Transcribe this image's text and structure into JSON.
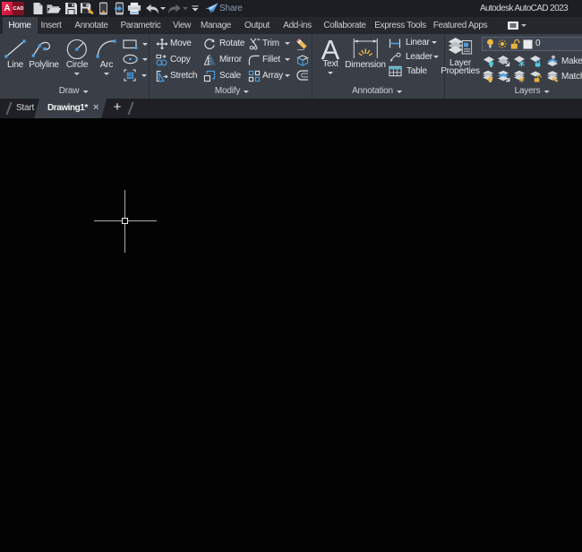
{
  "titlebar": {
    "logo_a": "A",
    "logo_cad": "CAD",
    "share_label": "Share",
    "window_title": "Autodesk AutoCAD 2023"
  },
  "ribbon_tabs": {
    "items": [
      {
        "label": "Home",
        "active": true
      },
      {
        "label": "Insert",
        "active": false
      },
      {
        "label": "Annotate",
        "active": false
      },
      {
        "label": "Parametric",
        "active": false
      },
      {
        "label": "View",
        "active": false
      },
      {
        "label": "Manage",
        "active": false
      },
      {
        "label": "Output",
        "active": false
      },
      {
        "label": "Add-ins",
        "active": false
      },
      {
        "label": "Collaborate",
        "active": false
      },
      {
        "label": "Express Tools",
        "active": false
      },
      {
        "label": "Featured Apps",
        "active": false
      }
    ]
  },
  "draw_panel": {
    "label": "Draw",
    "line": "Line",
    "polyline": "Polyline",
    "circle": "Circle",
    "arc": "Arc"
  },
  "modify_panel": {
    "label": "Modify",
    "move": "Move",
    "copy": "Copy",
    "stretch": "Stretch",
    "rotate": "Rotate",
    "mirror": "Mirror",
    "scale": "Scale",
    "trim": "Trim",
    "fillet": "Fillet",
    "array": "Array"
  },
  "annotation_panel": {
    "label": "Annotation",
    "text": "Text",
    "dimension": "Dimension",
    "linear": "Linear",
    "leader": "Leader",
    "table": "Table"
  },
  "layers_panel": {
    "label": "Layers",
    "layer_properties_line1": "Layer",
    "layer_properties_line2": "Properties",
    "current_layer": "0",
    "make_current": "Make Current",
    "match_layer": "Match Layer"
  },
  "file_tabs": {
    "start": "Start",
    "active": "Drawing1*",
    "close": "×",
    "new_tab": "+"
  },
  "colors": {
    "accent_blue": "#4ba0e0",
    "icon_yellow": "#f0b73e",
    "icon_cyan": "#4ec9e4",
    "logo_red": "#d6214c",
    "canvas_black": "#030304"
  }
}
